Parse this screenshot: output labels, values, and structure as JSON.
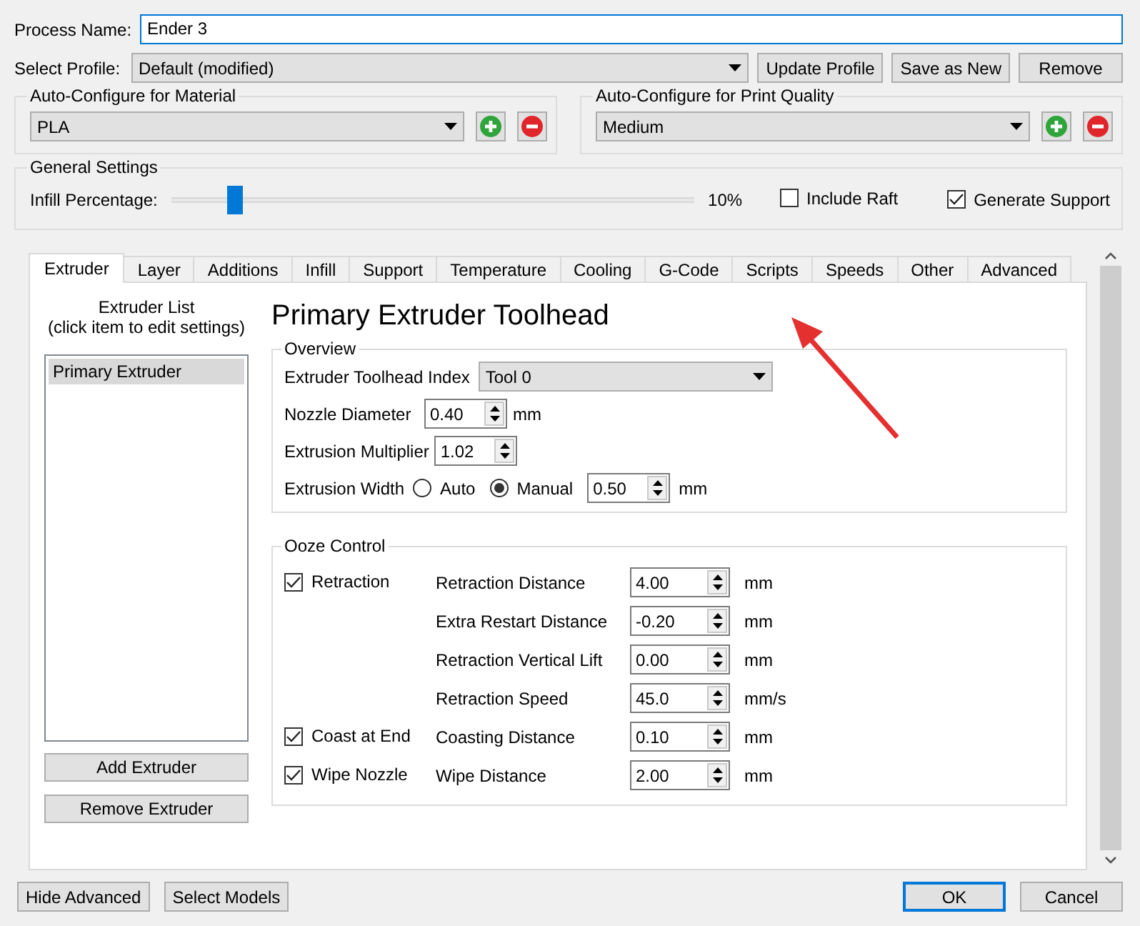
{
  "process_name": {
    "label": "Process Name:",
    "value": "Ender 3"
  },
  "profile": {
    "label": "Select Profile:",
    "value": "Default (modified)",
    "buttons": [
      "Update Profile",
      "Save as New",
      "Remove"
    ]
  },
  "auto_configure": [
    {
      "title": "Auto-Configure for Material",
      "value": "PLA"
    },
    {
      "title": "Auto-Configure for Print Quality",
      "value": "Medium"
    }
  ],
  "general": {
    "title": "General Settings",
    "infill": {
      "label": "Infill Percentage:",
      "level": 0.11,
      "reading": "10%"
    },
    "options": [
      {
        "label": "Include Raft",
        "checked": false
      },
      {
        "label": "Generate Support",
        "checked": true
      }
    ]
  },
  "tabs": [
    {
      "label": "Extruder",
      "selected": true
    },
    {
      "label": "Layer",
      "selected": false
    },
    {
      "label": "Additions",
      "selected": false
    },
    {
      "label": "Infill",
      "selected": false
    },
    {
      "label": "Support",
      "selected": false
    },
    {
      "label": "Temperature",
      "selected": false
    },
    {
      "label": "Cooling",
      "selected": false
    },
    {
      "label": "G-Code",
      "selected": false
    },
    {
      "label": "Scripts",
      "selected": false
    },
    {
      "label": "Speeds",
      "selected": false
    },
    {
      "label": "Other",
      "selected": false
    },
    {
      "label": "Advanced",
      "selected": false
    }
  ],
  "extruder_list": {
    "title": "Extruder List",
    "hint": "(click item to edit settings)",
    "items": [
      {
        "label": "Primary Extruder",
        "selected": true
      }
    ],
    "buttons": [
      "Add Extruder",
      "Remove Extruder"
    ]
  },
  "heading": "Primary Extruder Toolhead",
  "overview": {
    "title": "Overview",
    "rows": [
      {
        "kind": "select",
        "label": "Extruder Toolhead Index",
        "value": "Tool 0"
      },
      {
        "kind": "spin",
        "label": "Nozzle Diameter",
        "value": "0.40",
        "unit": "mm"
      },
      {
        "kind": "spin",
        "label": "Extrusion Multiplier",
        "value": "1.02"
      },
      {
        "kind": "radio",
        "label": "Extrusion Width",
        "options": [
          {
            "label": "Auto",
            "selected": false
          },
          {
            "label": "Manual",
            "selected": true
          }
        ],
        "value": "0.50",
        "unit": "mm"
      }
    ]
  },
  "ooze": {
    "title": "Ooze Control",
    "rows": [
      {
        "check": {
          "label": "Retraction",
          "checked": true
        },
        "label": "Retraction Distance",
        "value": "4.00",
        "unit": "mm"
      },
      {
        "label": "Extra Restart Distance",
        "value": "-0.20",
        "unit": "mm"
      },
      {
        "label": "Retraction Vertical Lift",
        "value": "0.00",
        "unit": "mm"
      },
      {
        "label": "Retraction Speed",
        "value": "45.0",
        "unit": "mm/s"
      },
      {
        "check": {
          "label": "Coast at End",
          "checked": true
        },
        "label": "Coasting Distance",
        "value": "0.10",
        "unit": "mm"
      },
      {
        "check": {
          "label": "Wipe Nozzle",
          "checked": true
        },
        "label": "Wipe Distance",
        "value": "2.00",
        "unit": "mm"
      }
    ]
  },
  "footer": {
    "left": [
      "Hide Advanced",
      "Select Models"
    ],
    "right": [
      {
        "label": "OK",
        "focused": true
      },
      {
        "label": "Cancel",
        "focused": false
      }
    ]
  }
}
